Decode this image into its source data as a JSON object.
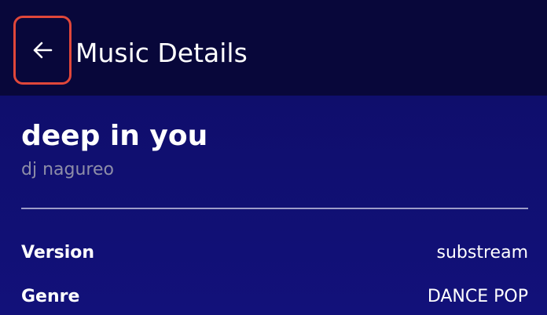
{
  "appbar": {
    "title": "Music Details",
    "back_icon": "arrow-left-icon"
  },
  "song": {
    "title": "deep in you",
    "artist": "dj nagureo"
  },
  "details": [
    {
      "label": "Version",
      "value": "substream"
    },
    {
      "label": "Genre",
      "value": "DANCE POP"
    }
  ],
  "colors": {
    "appbar_bg": "#08073a",
    "content_bg": "#100f6e",
    "highlight_border": "#e0473a"
  }
}
